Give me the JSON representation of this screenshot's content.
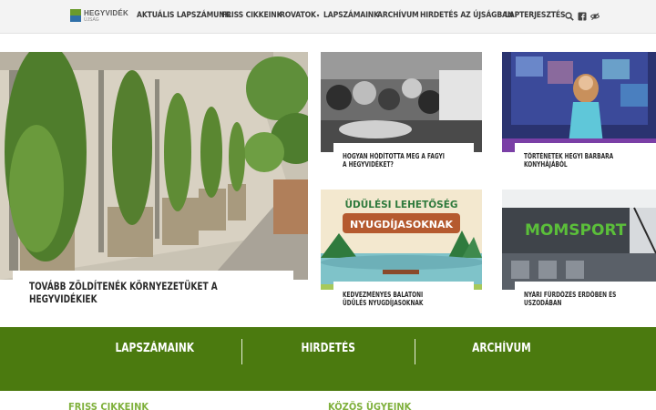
{
  "header": {
    "logo_name": "HEGYVIDÉK",
    "logo_sub": "ÚJSÁG",
    "nav": [
      {
        "label": "Aktuális lapszámunk",
        "dropdown": false
      },
      {
        "label": "Friss cikkeink",
        "dropdown": false
      },
      {
        "label": "Rovatok",
        "dropdown": true
      },
      {
        "label": "Lapszámaink",
        "dropdown": false
      },
      {
        "label": "Archívum",
        "dropdown": false
      },
      {
        "label": "Hirdetés az újságban",
        "dropdown": false
      },
      {
        "label": "Lapterjesztés",
        "dropdown": false
      }
    ],
    "tools": [
      "search-icon",
      "facebook-icon",
      "accessibility-icon"
    ]
  },
  "featured": {
    "main": {
      "title": "Tovább zöldítenék környezetüket a hegyvidékiek"
    },
    "cards": [
      {
        "title": "Hogyan hódította meg a fagyi a Hegyvidéket?"
      },
      {
        "title": "Történetek Hegyi Barbara konyhájából"
      },
      {
        "title": "Kedvezményes balatoni üdülés nyugdíjasoknak",
        "image_text_1": "ÜDÜLÉSI LEHETŐSÉG",
        "image_text_2": "NYUGDÍJASOKNAK"
      },
      {
        "title": "Nyári fürdőzés erdőben és uszodában",
        "image_text": "MOMSPORT"
      }
    ]
  },
  "band": {
    "links": [
      "Lapszámaink",
      "Hirdetés",
      "Archívum"
    ]
  },
  "sections": {
    "left": "Friss cikkeink",
    "right": "Közös ügyeink"
  },
  "colors": {
    "band": "#4b7a0f",
    "section_heading": "#7fb03c"
  }
}
